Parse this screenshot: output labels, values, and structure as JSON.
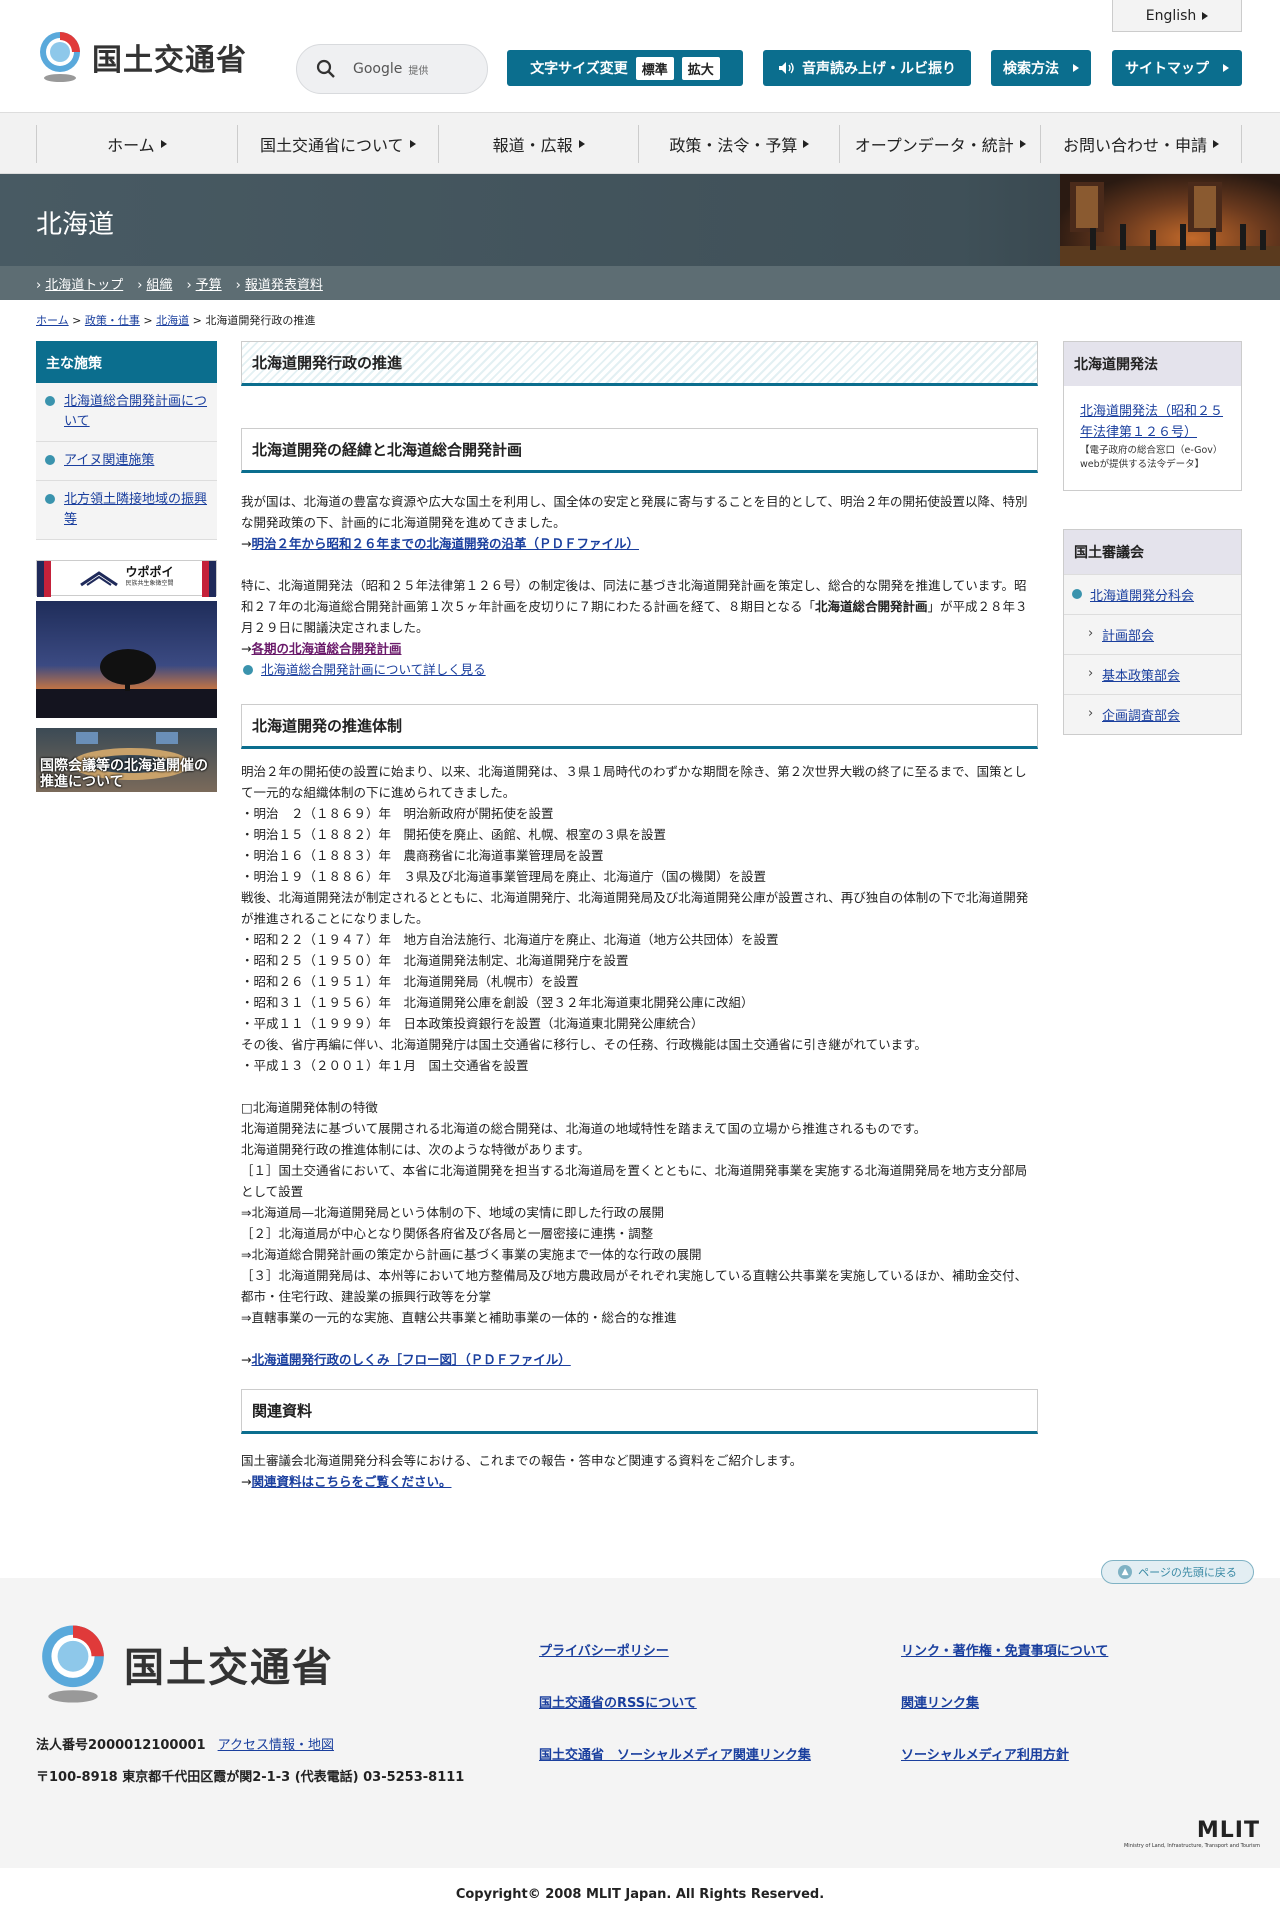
{
  "header": {
    "logo_text": "国土交通省",
    "search_label": "Google",
    "search_provider": "提供",
    "fontsize_label": "文字サイズ変更",
    "fontsize_normal": "標準",
    "fontsize_large": "拡大",
    "voice_label": "音声読み上げ・ルビ振り",
    "searchhow_label": "検索方法",
    "sitemap_label": "サイトマップ",
    "english_label": "English"
  },
  "gnav": [
    {
      "label": "ホーム"
    },
    {
      "label": "国土交通省について"
    },
    {
      "label": "報道・広報"
    },
    {
      "label": "政策・法令・予算"
    },
    {
      "label": "オープンデータ・統計"
    },
    {
      "label": "お問い合わせ・申請"
    }
  ],
  "region": {
    "title": "北海道",
    "subnav": [
      "北海道トップ",
      "組織",
      "予算",
      "報道発表資料"
    ]
  },
  "breadcrumb": {
    "items": [
      "ホーム",
      "政策・仕事",
      "北海道"
    ],
    "current": "北海道開発行政の推進",
    "sep": " > "
  },
  "leftbar": {
    "head": "主な施策",
    "items": [
      "北海道総合開発計画について",
      "アイヌ関連施策",
      "北方領土隣接地域の振興等"
    ],
    "upopoy_label": "ウポポイ",
    "upopoy_sub": "民族共生象徴空間",
    "banner2_text": "国際会議等の北海道開催の推進について"
  },
  "main": {
    "page_title": "北海道開発行政の推進",
    "sec1_title": "北海道開発の経緯と北海道総合開発計画",
    "sec1_p1": "我が国は、北海道の豊富な資源や広大な国土を利用し、国全体の安定と発展に寄与することを目的として、明治２年の開拓使設置以降、特別な開発政策の下、計画的に北海道開発を進めてきました。",
    "sec1_link1": "明治２年から昭和２６年までの北海道開発の沿革（ＰＤＦファイル）",
    "sec1_p2a": "特に、北海道開発法（昭和２５年法律第１２６号）の制定後は、同法に基づき北海道開発計画を策定し、総合的な開発を推進しています。昭和２７年の北海道総合開発計画第１次５ヶ年計画を皮切りに７期にわたる計画を経て、８期目となる「",
    "sec1_p2b": "北海道総合開発計画",
    "sec1_p2c": "」が平成２８年３月２９日に閣議決定されました。",
    "sec1_link2": "各期の北海道総合開発計画",
    "sec1_link3": "北海道総合開発計画について詳しく見る",
    "sec2_title": "北海道開発の推進体制",
    "sec2_lines": [
      "明治２年の開拓使の設置に始まり、以来、北海道開発は、３県１局時代のわずかな期間を除き、第２次世界大戦の終了に至るまで、国策として一元的な組織体制の下に進められてきました。",
      "・明治　２（１８６９）年　明治新政府が開拓使を設置",
      "・明治１５（１８８２）年　開拓使を廃止、函館、札幌、根室の３県を設置",
      "・明治１６（１８８３）年　農商務省に北海道事業管理局を設置",
      "・明治１９（１８８６）年　３県及び北海道事業管理局を廃止、北海道庁（国の機関）を設置",
      "戦後、北海道開発法が制定されるとともに、北海道開発庁、北海道開発局及び北海道開発公庫が設置され、再び独自の体制の下で北海道開発が推進されることになりました。",
      "・昭和２２（１９４７）年　地方自治法施行、北海道庁を廃止、北海道（地方公共団体）を設置",
      "・昭和２５（１９５０）年　北海道開発法制定、北海道開発庁を設置",
      "・昭和２６（１９５１）年　北海道開発局（札幌市）を設置",
      "・昭和３１（１９５６）年　北海道開発公庫を創設（翌３２年北海道東北開発公庫に改組）",
      "・平成１１（１９９９）年　日本政策投資銀行を設置（北海道東北開発公庫統合）",
      "その後、省庁再編に伴い、北海道開発庁は国土交通省に移行し、その任務、行政機能は国土交通省に引き継がれています。",
      "・平成１３（２００１）年１月　国土交通省を設置"
    ],
    "sec2_lines2": [
      "□北海道開発体制の特徴",
      "北海道開発法に基づいて展開される北海道の総合開発は、北海道の地域特性を踏まえて国の立場から推進されるものです。",
      "北海道開発行政の推進体制には、次のような特徴があります。",
      "［１］国土交通省において、本省に北海道開発を担当する北海道局を置くとともに、北海道開発事業を実施する北海道開発局を地方支分部局として設置",
      "⇒北海道局—北海道開発局という体制の下、地域の実情に即した行政の展開",
      "［２］北海道局が中心となり関係各府省及び各局と一層密接に連携・調整",
      "⇒北海道総合開発計画の策定から計画に基づく事業の実施まで一体的な行政の展開",
      "［３］北海道開発局は、本州等において地方整備局及び地方農政局がそれぞれ実施している直轄公共事業を実施しているほか、補助金交付、都市・住宅行政、建設業の振興行政等を分掌",
      "⇒直轄事業の一元的な実施、直轄公共事業と補助事業の一体的・総合的な推進"
    ],
    "sec2_link": "北海道開発行政のしくみ［フロー図］（ＰＤＦファイル）",
    "sec3_title": "関連資料",
    "sec3_p": "国土審議会北海道開発分科会等における、これまでの報告・答申など関連する資料をご紹介します。",
    "sec3_link": "関連資料はこちらをご覧ください。",
    "arrow": "→"
  },
  "rightbar": {
    "box1_head": "北海道開発法",
    "box1_link": "北海道開発法（昭和２５年法律第１２６号）",
    "box1_note": "【電子政府の総合窓口（e-Gov）webが提供する法令データ】",
    "box2_head": "国土審議会",
    "box2_main": "北海道開発分科会",
    "box2_subs": [
      "計画部会",
      "基本政策部会",
      "企画調査部会"
    ]
  },
  "pagetop_label": "ページの先頭に戻る",
  "footer": {
    "logo_text": "国土交通省",
    "corp_number": "法人番号2000012100001",
    "access_link": "アクセス情報・地図",
    "address": "〒100-8918 東京都千代田区霞が関2-1-3 (代表電話) 03-5253-8111",
    "links": [
      "プライバシーポリシー",
      "リンク・著作権・免責事項について",
      "国土交通省のRSSについて",
      "関連リンク集",
      "国土交通省　ソーシャルメディア関連リンク集",
      "ソーシャルメディア利用方針"
    ],
    "mlit_big": "MLIT",
    "mlit_small": "Ministry of Land, Infrastructure, Transport and Tourism",
    "copyright": "Copyright© 2008 MLIT Japan. All Rights Reserved."
  },
  "colors": {
    "accent": "#0b6e8e",
    "link": "#1a3f9e",
    "banner": "#485a63"
  }
}
